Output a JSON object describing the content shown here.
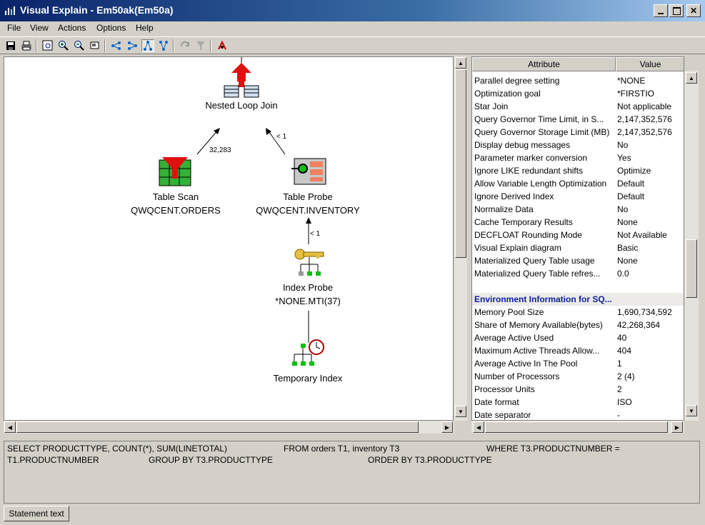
{
  "window": {
    "title": "Visual Explain - Em50ak(Em50a)"
  },
  "menu": [
    "File",
    "View",
    "Actions",
    "Options",
    "Help"
  ],
  "toolbar": {
    "icons": [
      "save-icon",
      "print-icon",
      "zoom-fit-icon",
      "zoom-in-icon",
      "zoom-out-icon",
      "overview-icon",
      "layout-left-right-icon",
      "layout-right-left-icon",
      "layout-top-bottom-icon",
      "layout-bottom-top-icon",
      "refresh-icon",
      "filter-icon",
      "highlight-icon"
    ]
  },
  "diagram": {
    "nodes": {
      "nested_loop_join": {
        "label": "Nested Loop Join"
      },
      "table_scan": {
        "label": "Table Scan",
        "object": "QWQCENT.ORDERS"
      },
      "table_probe": {
        "label": "Table Probe",
        "object": "QWQCENT.INVENTORY"
      },
      "index_probe": {
        "label": "Index Probe",
        "object": "*NONE.MTI(37)"
      },
      "temporary_index": {
        "label": "Temporary Index"
      }
    },
    "edges": {
      "scan_to_join": "32,283",
      "probe_to_join": "< 1",
      "index_to_probe": "< 1"
    }
  },
  "attributes": {
    "headers": {
      "attribute": "Attribute",
      "value": "Value"
    },
    "rows": [
      {
        "attr": "Parallel degree setting",
        "value": "*NONE"
      },
      {
        "attr": "Optimization goal",
        "value": "*FIRSTIO"
      },
      {
        "attr": "Star Join",
        "value": "Not applicable"
      },
      {
        "attr": "Query Governor Time Limit, in S...",
        "value": "2,147,352,576"
      },
      {
        "attr": "Query Governor Storage Limit (MB)",
        "value": "2,147,352,576"
      },
      {
        "attr": "Display debug messages",
        "value": "No"
      },
      {
        "attr": "Parameter marker conversion",
        "value": "Yes"
      },
      {
        "attr": "Ignore LIKE redundant shifts",
        "value": "Optimize"
      },
      {
        "attr": "Allow Variable Length Optimization",
        "value": "Default"
      },
      {
        "attr": "Ignore Derived Index",
        "value": "Default"
      },
      {
        "attr": "Normalize Data",
        "value": "No"
      },
      {
        "attr": "Cache Temporary Results",
        "value": "None"
      },
      {
        "attr": "DECFLOAT Rounding Mode",
        "value": "Not Available"
      },
      {
        "attr": "Visual Explain diagram",
        "value": "Basic"
      },
      {
        "attr": "Materialized Query Table usage",
        "value": "None"
      },
      {
        "attr": "Materialized Query Table refres...",
        "value": "0.0"
      },
      {
        "attr": "",
        "value": ""
      },
      {
        "attr": "Environment Information for SQ...",
        "value": "",
        "section": true
      },
      {
        "attr": "Memory Pool Size",
        "value": "1,690,734,592"
      },
      {
        "attr": "Share of Memory Available(bytes)",
        "value": "42,268,364"
      },
      {
        "attr": "Average Active Used",
        "value": "40"
      },
      {
        "attr": "Maximum Active Threads Allow...",
        "value": "404"
      },
      {
        "attr": "Average Active In The Pool",
        "value": "1"
      },
      {
        "attr": "Number of Processors",
        "value": "2 (4)"
      },
      {
        "attr": "Processor Units",
        "value": "2"
      },
      {
        "attr": "Date format",
        "value": "ISO"
      },
      {
        "attr": "Date separator",
        "value": "-"
      }
    ]
  },
  "statement": {
    "line1": [
      "SELECT PRODUCTTYPE, COUNT(*), SUM(LINETOTAL)",
      "FROM orders T1, inventory T3",
      "WHERE T3.PRODUCTNUMBER ="
    ],
    "line2": [
      "T1.PRODUCTNUMBER",
      "GROUP BY T3.PRODUCTTYPE",
      "ORDER BY T3.PRODUCTTYPE"
    ],
    "tab": "Statement text"
  }
}
